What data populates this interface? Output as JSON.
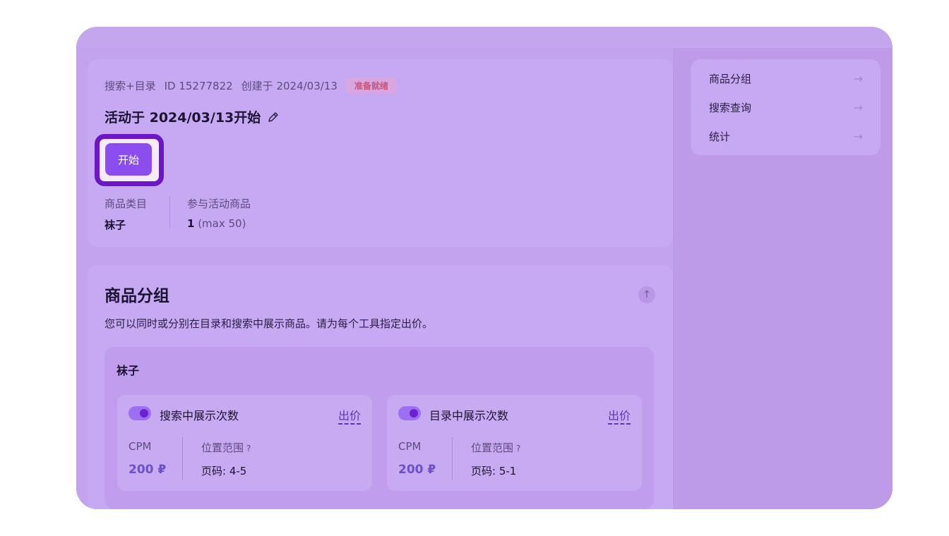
{
  "campaign": {
    "type": "搜索+目录",
    "id_text": "ID 15277822",
    "created_text": "创建于 2024/03/13",
    "status": "准备就绪",
    "title": "活动于 2024/03/13开始",
    "start_button": "开始"
  },
  "stats": [
    {
      "label": "商品类目",
      "value": "袜子",
      "suffix": ""
    },
    {
      "label": "参与活动商品",
      "value": "1",
      "suffix": " (max 50)"
    }
  ],
  "groups_section": {
    "title": "商品分组",
    "description": "您可以同时或分别在目录和搜索中展示商品。请为每个工具指定出价。",
    "group": {
      "title": "袜子",
      "tools": [
        {
          "title": "搜索中展示次数",
          "bid_label": "出价",
          "metric_label": "CPM",
          "metric_value": "200 ₽",
          "position_label": "位置范围",
          "position_hint": "?",
          "position_value": "页码: 4-5",
          "enabled": true
        },
        {
          "title": "目录中展示次数",
          "bid_label": "出价",
          "metric_label": "CPM",
          "metric_value": "200 ₽",
          "position_label": "位置范围",
          "position_hint": "?",
          "position_value": "页码: 5-1",
          "enabled": true
        }
      ]
    }
  },
  "side_nav": {
    "items": [
      {
        "label": "商品分组",
        "icon": "arrow-right-icon"
      },
      {
        "label": "搜索查询",
        "icon": "arrow-right-icon"
      },
      {
        "label": "统计",
        "icon": "arrow-right-icon"
      }
    ]
  },
  "colors": {
    "accent": "#8b4df0",
    "highlight_ring": "#6c16c7",
    "status_text": "#c4557a"
  }
}
